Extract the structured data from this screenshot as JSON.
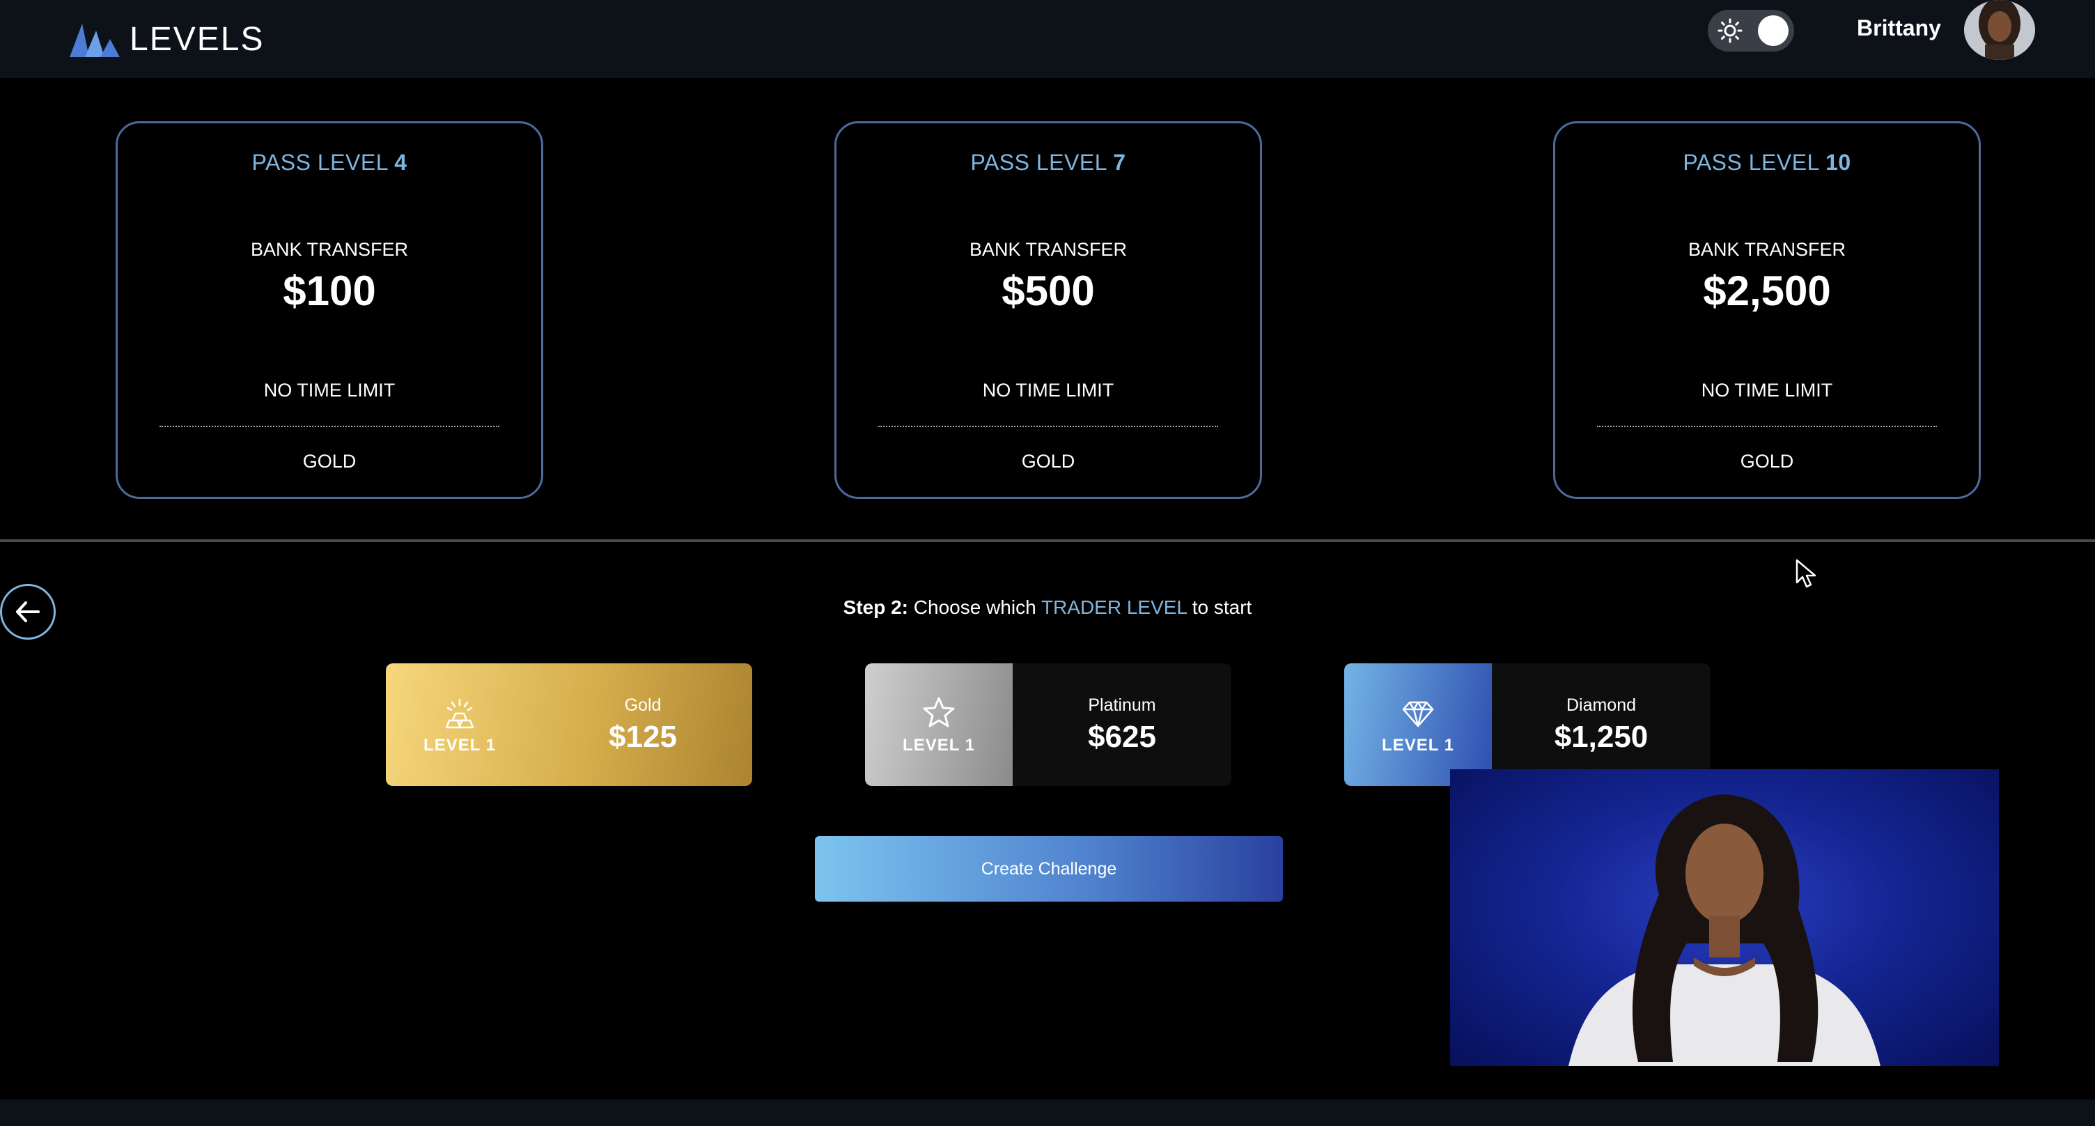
{
  "header": {
    "logo_text": "LEVELS",
    "user_name": "Brittany"
  },
  "pass_cards": [
    {
      "title_prefix": "PASS LEVEL",
      "title_number": "4",
      "method": "BANK TRANSFER",
      "amount": "$100",
      "time_limit": "NO TIME LIMIT",
      "tier": "GOLD"
    },
    {
      "title_prefix": "PASS LEVEL",
      "title_number": "7",
      "method": "BANK TRANSFER",
      "amount": "$500",
      "time_limit": "NO TIME LIMIT",
      "tier": "GOLD"
    },
    {
      "title_prefix": "PASS LEVEL",
      "title_number": "10",
      "method": "BANK TRANSFER",
      "amount": "$2,500",
      "time_limit": "NO TIME LIMIT",
      "tier": "GOLD"
    }
  ],
  "step": {
    "prefix": "Step 2:",
    "text_before": "Choose which",
    "accent": "TRADER LEVEL",
    "text_after": "to start"
  },
  "trader_levels": [
    {
      "name": "Gold",
      "level": "LEVEL 1",
      "price": "$125",
      "icon": "gold-bars-icon",
      "color": "#d6ae4c"
    },
    {
      "name": "Platinum",
      "level": "LEVEL 1",
      "price": "$625",
      "icon": "star-icon",
      "color": "#a9a9a9"
    },
    {
      "name": "Diamond",
      "level": "LEVEL 1",
      "price": "$1,250",
      "icon": "diamond-icon",
      "color": "#4a7fd0"
    }
  ],
  "actions": {
    "create_label": "Create Challenge"
  },
  "colors": {
    "accent": "#7fb6e0",
    "card_border": "#4e6a9c",
    "header_bg": "#0d1118",
    "webcam_bg": "#142592"
  }
}
